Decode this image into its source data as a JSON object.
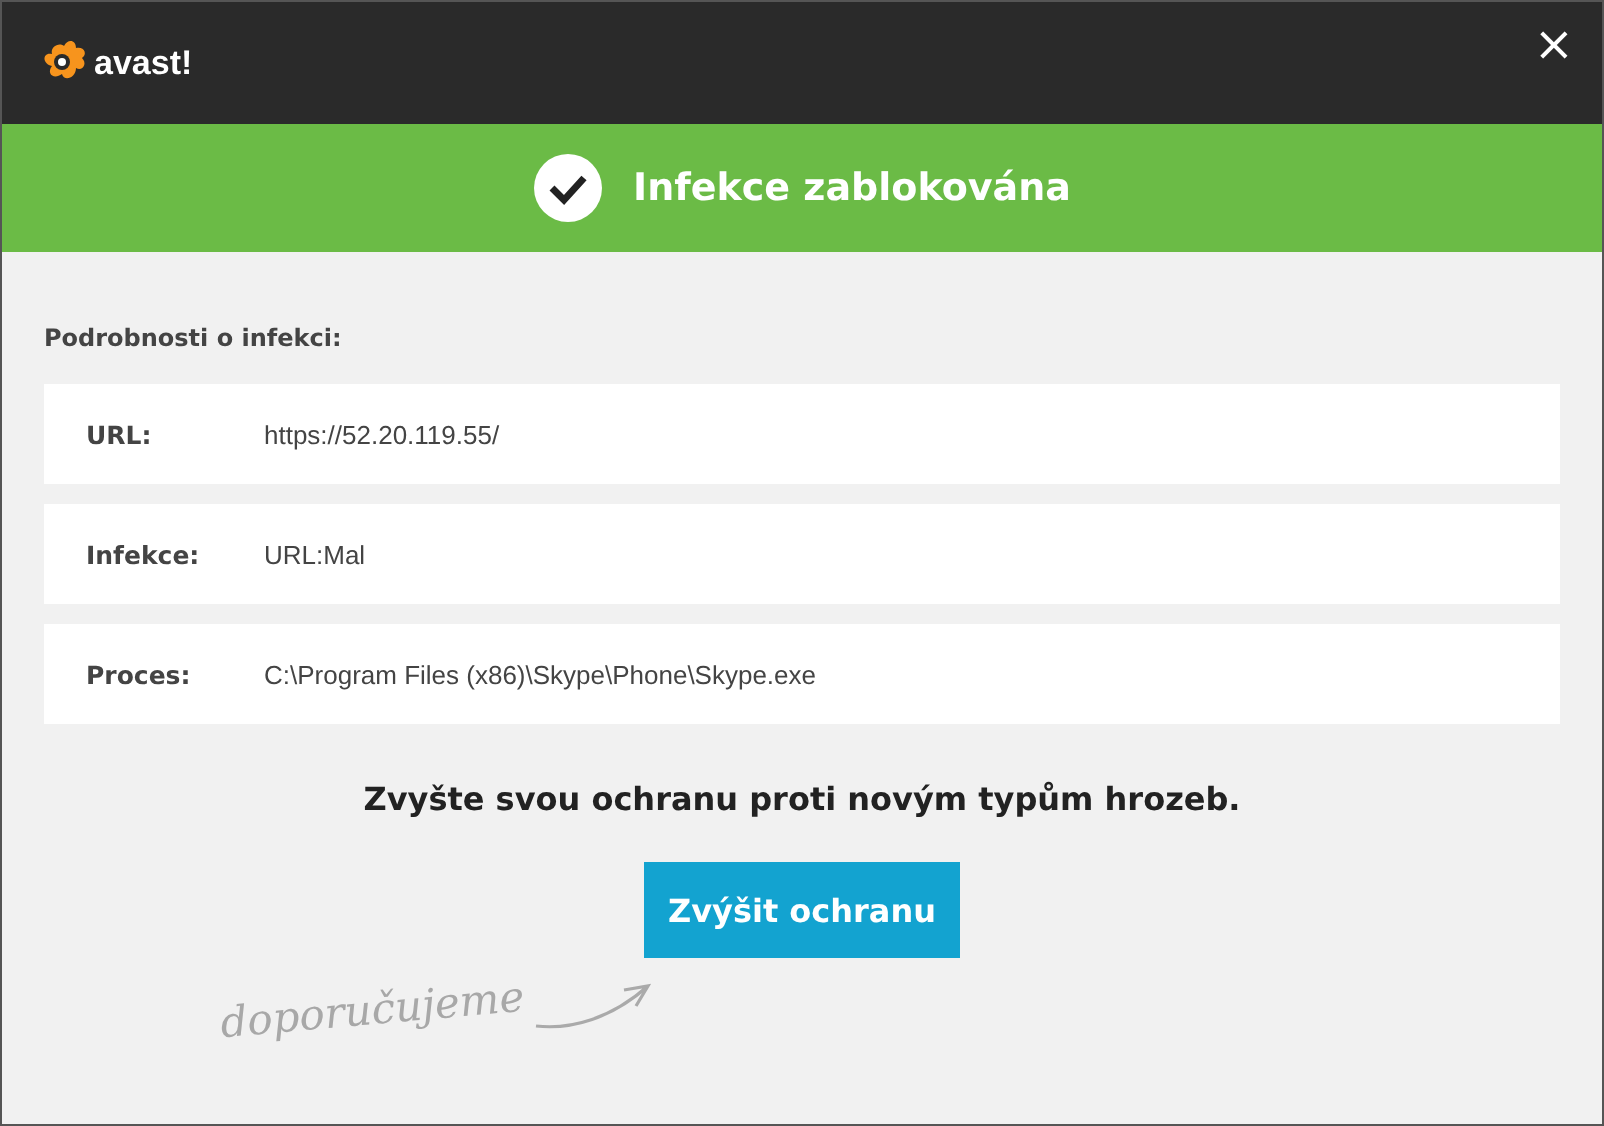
{
  "window": {
    "logo": "avast!",
    "close": "×"
  },
  "banner": {
    "title": "Infekce zablokována"
  },
  "details": {
    "heading": "Podrobnosti o infekci:",
    "rows": [
      {
        "label": "URL:",
        "value": "https://52.20.119.55/"
      },
      {
        "label": "Infekce:",
        "value": "URL:Mal"
      },
      {
        "label": "Proces:",
        "value": "C:\\Program Files (x86)\\Skype\\Phone\\Skype.exe"
      }
    ]
  },
  "message": "Zvyšte svou ochranu proti novým typům hrozeb.",
  "button": "Zvýšit ochranu",
  "recommend": "doporučujeme"
}
